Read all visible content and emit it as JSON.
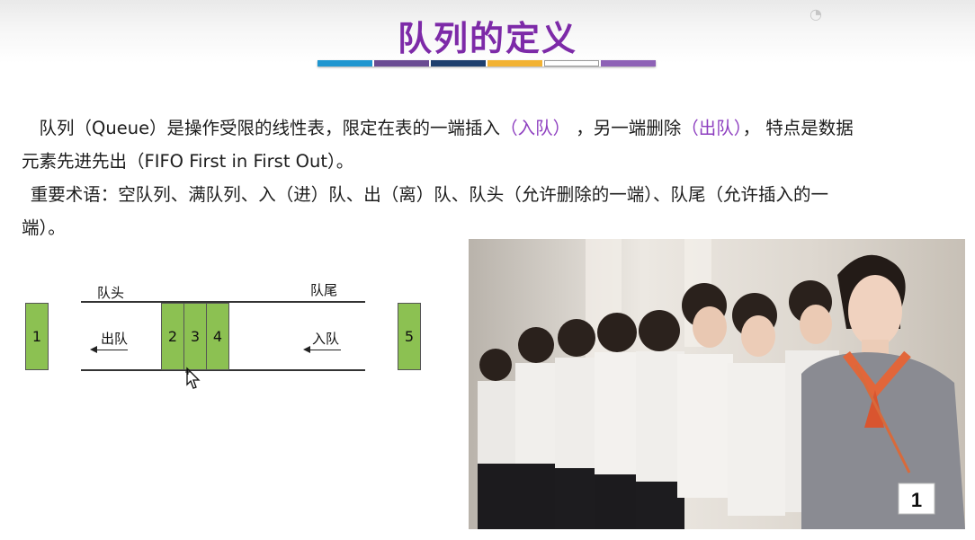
{
  "slide": {
    "title": "队列的定义",
    "color_bar": [
      "#1f96d0",
      "#6a4c93",
      "#1e3f6e",
      "#f2b233",
      "#ffffff",
      "#8e62b6"
    ],
    "para1": {
      "line1_a": "队列（Queue）是操作受限的线性表，限定在表的一端插入",
      "line1_enqueue": "（入队）",
      "line1_b": "，另一端删除",
      "line1_dequeue": "（出队）",
      "line1_c": "，  特点是数据",
      "line2": "元素先进先出（FIFO  First in First Out）。"
    },
    "para2": {
      "line1": "重要术语：空队列、满队列、入（进）队、出（离）队、队头（允许删除的一端）、队尾（允许插入的一",
      "line2": "端）。"
    }
  },
  "diagram": {
    "head_label": "队头",
    "tail_label": "队尾",
    "dequeue_label": "出队",
    "enqueue_label": "入队",
    "box_out": "1",
    "queue_boxes": [
      "2",
      "3",
      "4"
    ],
    "box_in": "5",
    "box_color": "#8cc152"
  },
  "photo": {
    "number_tag": "1"
  }
}
